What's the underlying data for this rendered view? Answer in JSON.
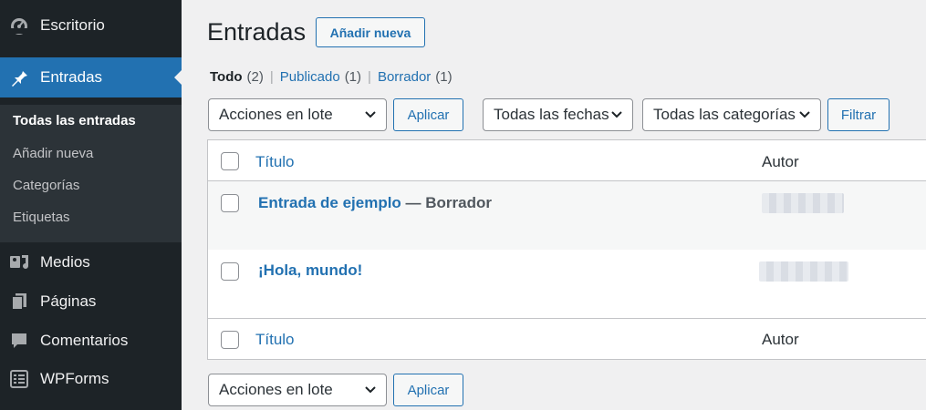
{
  "sidebar": {
    "items": [
      {
        "label": "Escritorio",
        "icon": "dashboard-icon"
      },
      {
        "label": "Entradas",
        "icon": "pin-icon"
      },
      {
        "label": "Medios",
        "icon": "media-icon"
      },
      {
        "label": "Páginas",
        "icon": "pages-icon"
      },
      {
        "label": "Comentarios",
        "icon": "comments-icon"
      },
      {
        "label": "WPForms",
        "icon": "wpforms-icon"
      }
    ],
    "submenu": [
      {
        "label": "Todas las entradas"
      },
      {
        "label": "Añadir nueva"
      },
      {
        "label": "Categorías"
      },
      {
        "label": "Etiquetas"
      }
    ]
  },
  "header": {
    "title": "Entradas",
    "add_new": "Añadir nueva"
  },
  "filters": {
    "all_label": "Todo",
    "all_count": "(2)",
    "published_label": "Publicado",
    "published_count": "(1)",
    "draft_label": "Borrador",
    "draft_count": "(1)",
    "separator": "|"
  },
  "toolbar": {
    "bulk_actions": "Acciones en lote",
    "apply": "Aplicar",
    "dates": "Todas las fechas",
    "categories": "Todas las categorías",
    "filter": "Filtrar"
  },
  "table": {
    "columns": {
      "title": "Título",
      "author": "Autor"
    },
    "rows": [
      {
        "title": "Entrada de ejemplo",
        "state": " — Borrador"
      },
      {
        "title": "¡Hola, mundo!",
        "state": ""
      }
    ]
  },
  "colors": {
    "sidebar_bg": "#1d2327",
    "accent": "#2271b1",
    "page_bg": "#f0f0f1"
  }
}
